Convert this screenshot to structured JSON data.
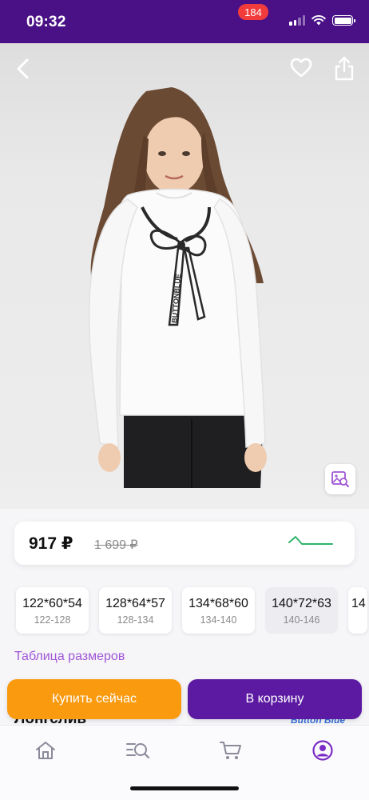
{
  "status_bar": {
    "time": "09:32"
  },
  "product": {
    "price_current": "917 ₽",
    "price_old": "1 699 ₽",
    "title": "Лонгслив",
    "brand": "Button Blue",
    "print_text": "BUTTONBLUE"
  },
  "sizes": [
    {
      "main": "122*60*54",
      "sub": "122-128",
      "selected": false
    },
    {
      "main": "128*64*57",
      "sub": "128-134",
      "selected": false
    },
    {
      "main": "134*68*60",
      "sub": "134-140",
      "selected": false
    },
    {
      "main": "140*72*63",
      "sub": "140-146",
      "selected": true
    },
    {
      "main": "14",
      "sub": "",
      "selected": false
    }
  ],
  "links": {
    "size_table": "Таблица размеров"
  },
  "actions": {
    "buy_now": "Купить сейчас",
    "add_to_cart": "В корзину"
  },
  "tab_bar": {
    "cart_badge": "184"
  },
  "colors": {
    "brand_purple": "#5b1aa1",
    "status_bar": "#4a1187",
    "buy_orange": "#f99a0f",
    "trend_green": "#2fb36b",
    "link_purple": "#a056d6",
    "badge_red": "#f23c3c"
  },
  "icons": [
    "back-icon",
    "heart-icon",
    "share-icon",
    "image-search-icon",
    "home-icon",
    "catalog-search-icon",
    "cart-icon",
    "profile-icon"
  ]
}
